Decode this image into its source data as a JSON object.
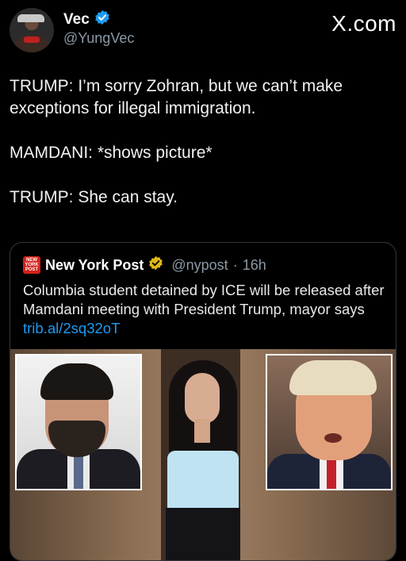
{
  "author": {
    "display_name": "Vec",
    "handle": "@YungVec",
    "verified_icon": "verified-badge-icon"
  },
  "brand": "X.com",
  "tweet": {
    "lines": [
      "TRUMP: I’m sorry Zohran, but we can’t make exceptions for illegal immigration.",
      "MAMDANI: *shows picture*",
      "TRUMP: She can stay."
    ]
  },
  "quote": {
    "logo_text": "NEW YORK POST",
    "name": "New York Post",
    "verified_icon": "gold-verified-badge-icon",
    "handle": "@nypost",
    "separator": "·",
    "time": "16h",
    "text": "Columbia student detained by ICE will be released after Mamdani meeting with President Trump, mayor says",
    "link": "trib.al/2sq32oT"
  },
  "colors": {
    "background": "#000000",
    "link": "#1d9bf0",
    "verified_blue": "#1d9bf0",
    "verified_gold": "#e2b719",
    "nyp_red": "#d6201a"
  }
}
